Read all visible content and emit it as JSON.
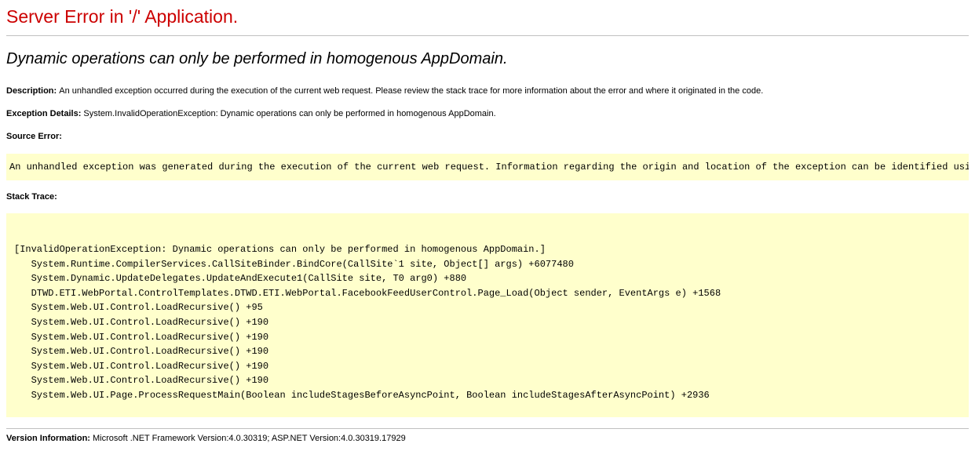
{
  "title": "Server Error in '/' Application.",
  "exceptionMessage": "Dynamic operations can only be performed in homogenous AppDomain.",
  "description": {
    "label": "Description: ",
    "value": "An unhandled exception occurred during the execution of the current web request. Please review the stack trace for more information about the error and where it originated in the code."
  },
  "exceptionDetails": {
    "label": "Exception Details: ",
    "value": "System.InvalidOperationException: Dynamic operations can only be performed in homogenous AppDomain."
  },
  "sourceError": {
    "label": "Source Error:",
    "code": "An unhandled exception was generated during the execution of the current web request. Information regarding the origin and location of the exception can be identified using the exception stack trace below."
  },
  "stackTrace": {
    "label": "Stack Trace:",
    "code": "\n[InvalidOperationException: Dynamic operations can only be performed in homogenous AppDomain.]\n   System.Runtime.CompilerServices.CallSiteBinder.BindCore(CallSite`1 site, Object[] args) +6077480\n   System.Dynamic.UpdateDelegates.UpdateAndExecute1(CallSite site, T0 arg0) +880\n   DTWD.ETI.WebPortal.ControlTemplates.DTWD.ETI.WebPortal.FacebookFeedUserControl.Page_Load(Object sender, EventArgs e) +1568\n   System.Web.UI.Control.LoadRecursive() +95\n   System.Web.UI.Control.LoadRecursive() +190\n   System.Web.UI.Control.LoadRecursive() +190\n   System.Web.UI.Control.LoadRecursive() +190\n   System.Web.UI.Control.LoadRecursive() +190\n   System.Web.UI.Control.LoadRecursive() +190\n   System.Web.UI.Page.ProcessRequestMain(Boolean includeStagesBeforeAsyncPoint, Boolean includeStagesAfterAsyncPoint) +2936\n"
  },
  "versionInfo": {
    "label": "Version Information: ",
    "value": "Microsoft .NET Framework Version:4.0.30319; ASP.NET Version:4.0.30319.17929"
  }
}
